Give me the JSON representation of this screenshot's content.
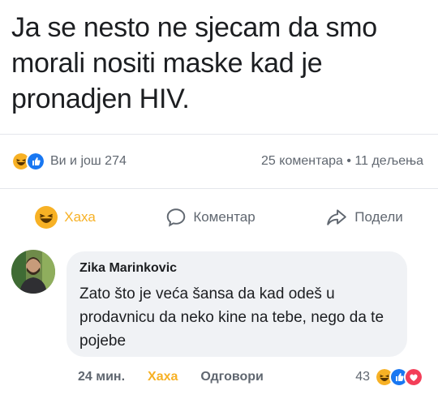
{
  "post": {
    "text": "Ja se nesto ne sjecam da smo morali nositi maske kad je pronadjen HIV."
  },
  "stats": {
    "reactions_text": "Ви и још 274",
    "comments_shares": "25 коментара • 11 дељења",
    "reaction_icons": [
      "haha-icon",
      "like-icon"
    ]
  },
  "actions": {
    "haha_label": "Хаха",
    "comment_label": "Коментар",
    "share_label": "Подели"
  },
  "comment": {
    "author": "Zika Marinkovic",
    "text": "Zato što je veća šansa da kad odeš u prodavnicu da neko kine na tebe, nego da te pojebe",
    "time": "24 мин.",
    "haha_label": "Хаха",
    "reply_label": "Одговори",
    "reaction_count": "43",
    "reaction_icons": [
      "haha-icon",
      "like-icon",
      "love-icon"
    ]
  },
  "colors": {
    "haha": "#f7b125",
    "like": "#1877f2",
    "love": "#f33e58",
    "muted": "#606770",
    "bubble": "#f0f2f5"
  }
}
